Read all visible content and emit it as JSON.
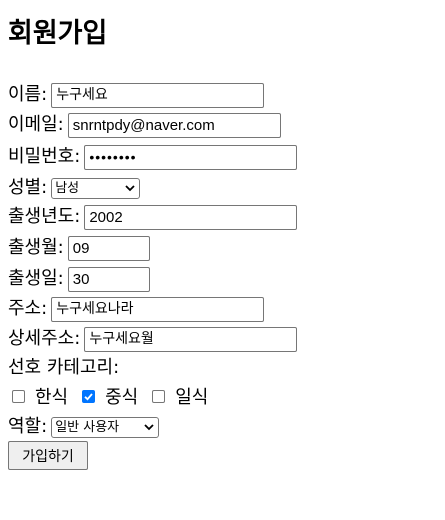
{
  "form": {
    "title": "회원가입",
    "fields": {
      "name": {
        "label": "이름:",
        "value": "누구세요"
      },
      "email": {
        "label": "이메일:",
        "value": "snrntpdy@naver.com"
      },
      "password": {
        "label": "비밀번호:",
        "value": "••••••••"
      },
      "gender": {
        "label": "성별:",
        "value": "남성"
      },
      "birth_year": {
        "label": "출생년도:",
        "value": "2002"
      },
      "birth_month": {
        "label": "출생월:",
        "value": "09"
      },
      "birth_day": {
        "label": "출생일:",
        "value": "30"
      },
      "address": {
        "label": "주소:",
        "value": "누구세요나라"
      },
      "address_detail": {
        "label": "상세주소:",
        "value": "누구세요월"
      },
      "role": {
        "label": "역할:",
        "value": "일반 사용자"
      }
    },
    "categories": {
      "label": "선호 카테고리:",
      "options": [
        {
          "label": "한식",
          "checked": false
        },
        {
          "label": "중식",
          "checked": true
        },
        {
          "label": "일식",
          "checked": false
        }
      ]
    },
    "submit_label": "가입하기"
  },
  "colors": {
    "checkbox_checked": "#0075ff",
    "border": "#767676",
    "button_bg": "#efefef"
  }
}
